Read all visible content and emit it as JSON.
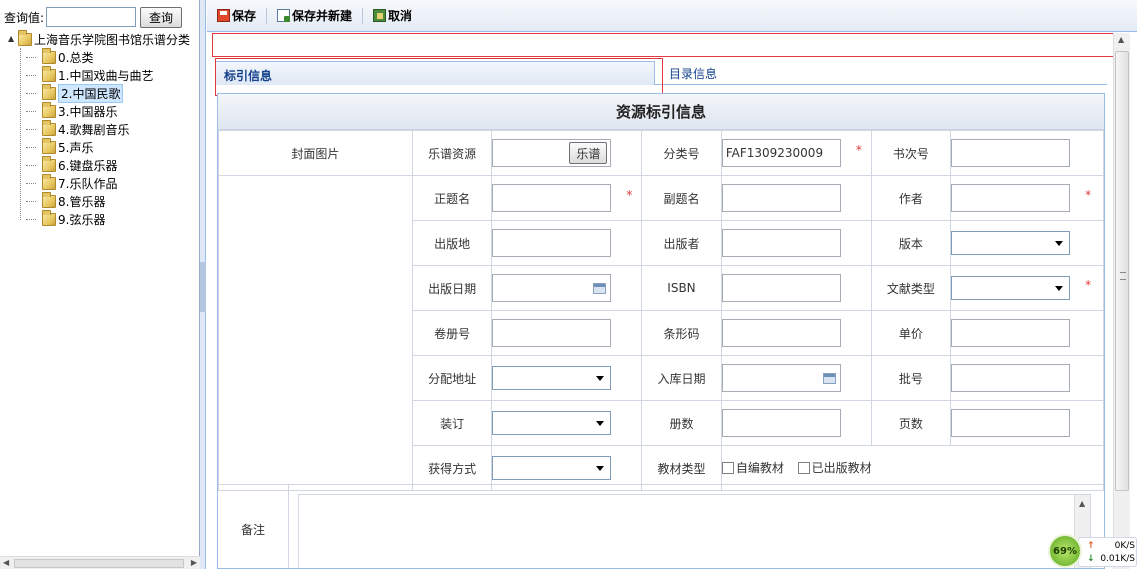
{
  "search": {
    "label": "查询值:",
    "button": "查询",
    "value": ""
  },
  "tree": {
    "root": "上海音乐学院图书馆乐谱分类",
    "items": [
      "0.总类",
      "1.中国戏曲与曲艺",
      "2.中国民歌",
      "3.中国器乐",
      "4.歌舞剧音乐",
      "5.声乐",
      "6.键盘乐器",
      "7.乐队作品",
      "8.管乐器",
      "9.弦乐器"
    ],
    "selected_index": 2
  },
  "toolbar": {
    "save": "保存",
    "save_new": "保存并新建",
    "cancel": "取消"
  },
  "tabs": {
    "index_info": "标引信息",
    "catalog_info": "目录信息"
  },
  "panel": {
    "title": "资源标引信息"
  },
  "form": {
    "cover": "封面图片",
    "score_resource": "乐谱资源",
    "score_button": "乐谱",
    "class_no": "分类号",
    "class_no_value": "FAF1309230009",
    "copy_no": "书次号",
    "main_title": "正题名",
    "subtitle": "副题名",
    "author": "作者",
    "pub_place": "出版地",
    "publisher": "出版者",
    "edition": "版本",
    "pub_date": "出版日期",
    "isbn": "ISBN",
    "doc_type": "文献类型",
    "volume": "卷册号",
    "barcode": "条形码",
    "unit_price": "单价",
    "alloc_addr": "分配地址",
    "stock_date": "入库日期",
    "batch_no": "批号",
    "binding": "装订",
    "copies": "册数",
    "pages": "页数",
    "acquire_method": "获得方式",
    "textbook_type": "教材类型",
    "self_textbook": "自编教材",
    "published_textbook": "已出版教材",
    "remark": "备注"
  },
  "net": {
    "percent": "69%",
    "up": "0K/S",
    "down": "0.01K/S"
  },
  "colors": {
    "required": "#b21f1f",
    "accent": "#15428b",
    "highlight": "#e0393e"
  }
}
